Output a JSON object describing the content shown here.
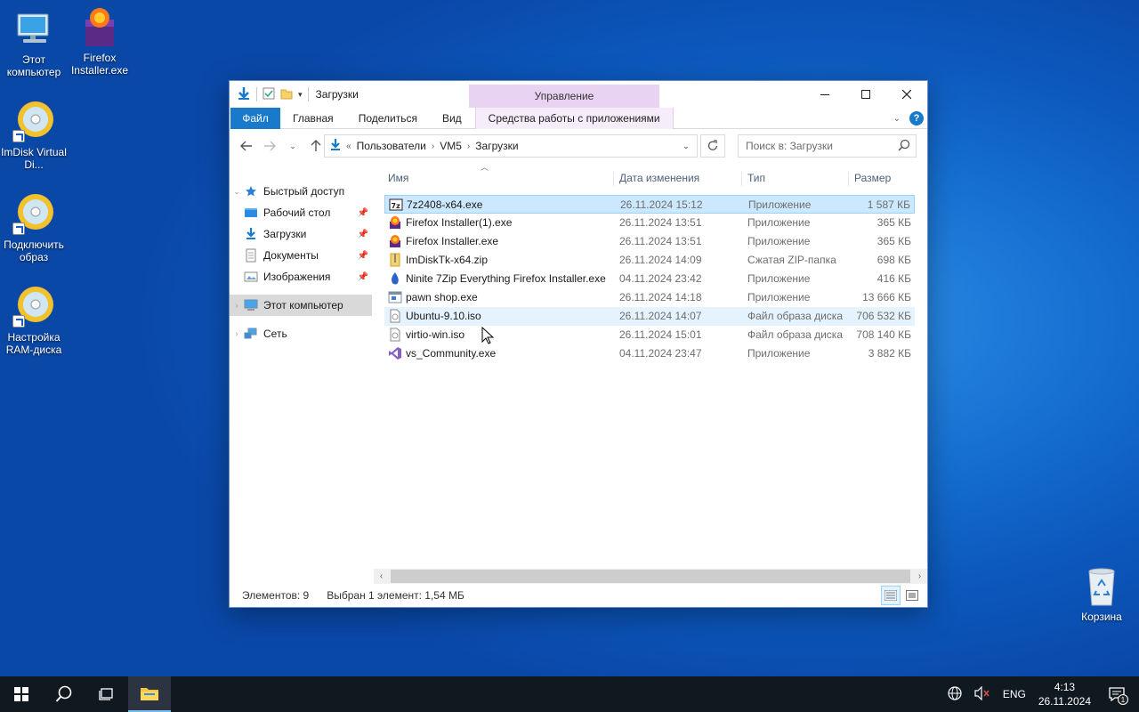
{
  "desktop": {
    "icons": [
      {
        "label": "Этот компьютер"
      },
      {
        "label": "Firefox Installer.exe"
      },
      {
        "label": "ImDisk Virtual Di..."
      },
      {
        "label": "Подключить образ"
      },
      {
        "label": "Настройка RAM-диска"
      }
    ],
    "recycle_bin": "Корзина"
  },
  "window": {
    "title": "Загрузки",
    "contextual_tab_group": "Управление",
    "ribbon_tabs": {
      "file": "Файл",
      "home": "Главная",
      "share": "Поделиться",
      "view": "Вид",
      "app_tools": "Средства работы с приложениями"
    },
    "address": {
      "overflow": "«",
      "crumbs": [
        "Пользователи",
        "VM5",
        "Загрузки"
      ]
    },
    "search_placeholder": "Поиск в: Загрузки",
    "columns": {
      "name": "Имя",
      "date": "Дата изменения",
      "type": "Тип",
      "size": "Размер"
    },
    "sidebar": {
      "quick_access": "Быстрый доступ",
      "desktop": "Рабочий стол",
      "downloads": "Загрузки",
      "documents": "Документы",
      "pictures": "Изображения",
      "this_pc": "Этот компьютер",
      "network": "Сеть"
    },
    "files": [
      {
        "name": "7z2408-x64.exe",
        "date": "26.11.2024 15:12",
        "type": "Приложение",
        "size": "1 587 КБ"
      },
      {
        "name": "Firefox Installer(1).exe",
        "date": "26.11.2024 13:51",
        "type": "Приложение",
        "size": "365 КБ"
      },
      {
        "name": "Firefox Installer.exe",
        "date": "26.11.2024 13:51",
        "type": "Приложение",
        "size": "365 КБ"
      },
      {
        "name": "ImDiskTk-x64.zip",
        "date": "26.11.2024 14:09",
        "type": "Сжатая ZIP-папка",
        "size": "698 КБ"
      },
      {
        "name": "Ninite 7Zip Everything Firefox Installer.exe",
        "date": "04.11.2024 23:42",
        "type": "Приложение",
        "size": "416 КБ"
      },
      {
        "name": "pawn shop.exe",
        "date": "26.11.2024 14:18",
        "type": "Приложение",
        "size": "13 666 КБ"
      },
      {
        "name": "Ubuntu-9.10.iso",
        "date": "26.11.2024 14:07",
        "type": "Файл образа диска",
        "size": "706 532 КБ"
      },
      {
        "name": "virtio-win.iso",
        "date": "26.11.2024 15:01",
        "type": "Файл образа диска",
        "size": "708 140 КБ"
      },
      {
        "name": "vs_Community.exe",
        "date": "04.11.2024 23:47",
        "type": "Приложение",
        "size": "3 882 КБ"
      }
    ],
    "status": {
      "count": "Элементов: 9",
      "selection": "Выбран 1 элемент: 1,54 МБ"
    }
  },
  "taskbar": {
    "lang": "ENG",
    "time": "4:13",
    "date": "26.11.2024",
    "notifications": "1"
  },
  "colors": {
    "accent": "#1979ca",
    "selection": "#cce8ff",
    "manage_tab": "#e9d3f2"
  }
}
